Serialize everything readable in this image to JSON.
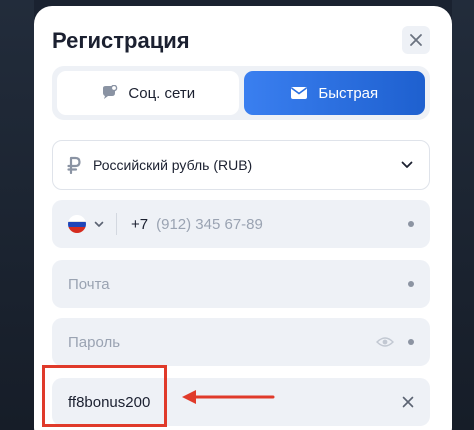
{
  "modal": {
    "title": "Регистрация",
    "tabs": [
      {
        "label": "Соц. сети",
        "icon": "chat-bubble-icon",
        "active": false
      },
      {
        "label": "Быстрая",
        "icon": "envelope-icon",
        "active": true
      }
    ],
    "currency": {
      "icon": "ruble-icon",
      "label": "Российский рубль (RUB)"
    },
    "phone": {
      "country_code": "+7",
      "placeholder": "(912) 345 67-89",
      "flag": "russia-flag-icon"
    },
    "email": {
      "placeholder": "Почта"
    },
    "password": {
      "placeholder": "Пароль"
    },
    "promo": {
      "value": "ff8bonus200"
    }
  },
  "colors": {
    "accent": "#2f74e8",
    "annotation": "#e03a2a",
    "field_bg": "#eef1f6"
  }
}
